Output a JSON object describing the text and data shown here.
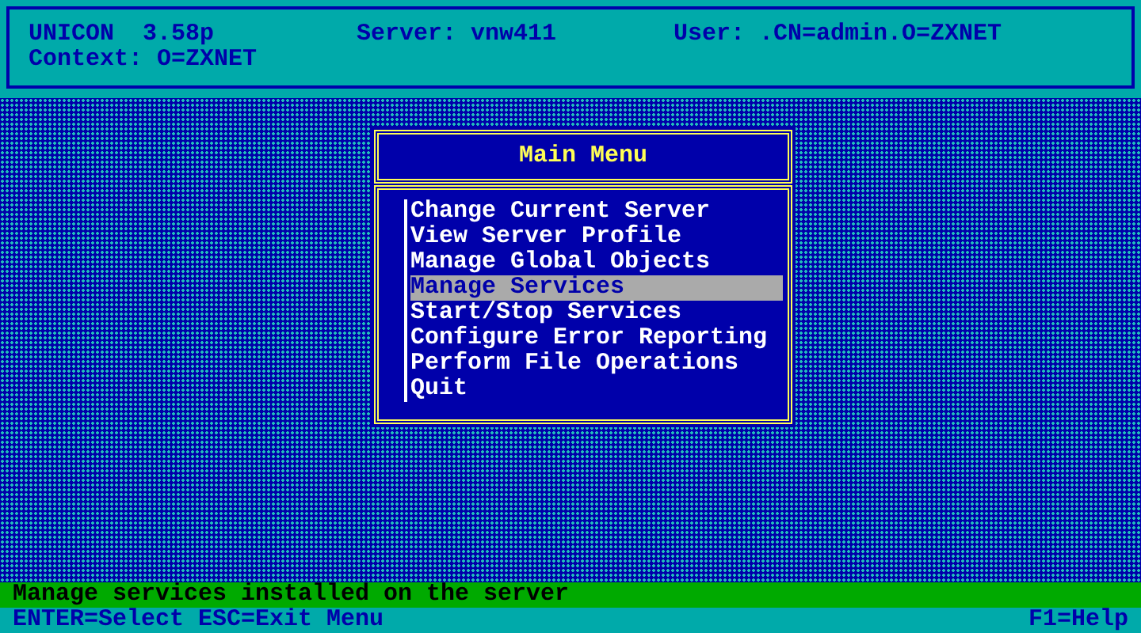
{
  "header": {
    "product": "UNICON  3.58p",
    "server": "Server: vnw411",
    "user": "User: .CN=admin.O=ZXNET",
    "context": "Context: O=ZXNET"
  },
  "menu": {
    "title": "Main Menu",
    "items": [
      {
        "label": "Change Current Server",
        "selected": false
      },
      {
        "label": "View Server Profile",
        "selected": false
      },
      {
        "label": "Manage Global Objects",
        "selected": false
      },
      {
        "label": "Manage Services",
        "selected": true
      },
      {
        "label": "Start/Stop Services",
        "selected": false
      },
      {
        "label": "Configure Error Reporting",
        "selected": false
      },
      {
        "label": "Perform File Operations",
        "selected": false
      },
      {
        "label": "Quit",
        "selected": false
      }
    ]
  },
  "status_bar": {
    "description": "Manage services installed on the server",
    "keys": "ENTER=Select ESC=Exit Menu",
    "help": "F1=Help"
  }
}
